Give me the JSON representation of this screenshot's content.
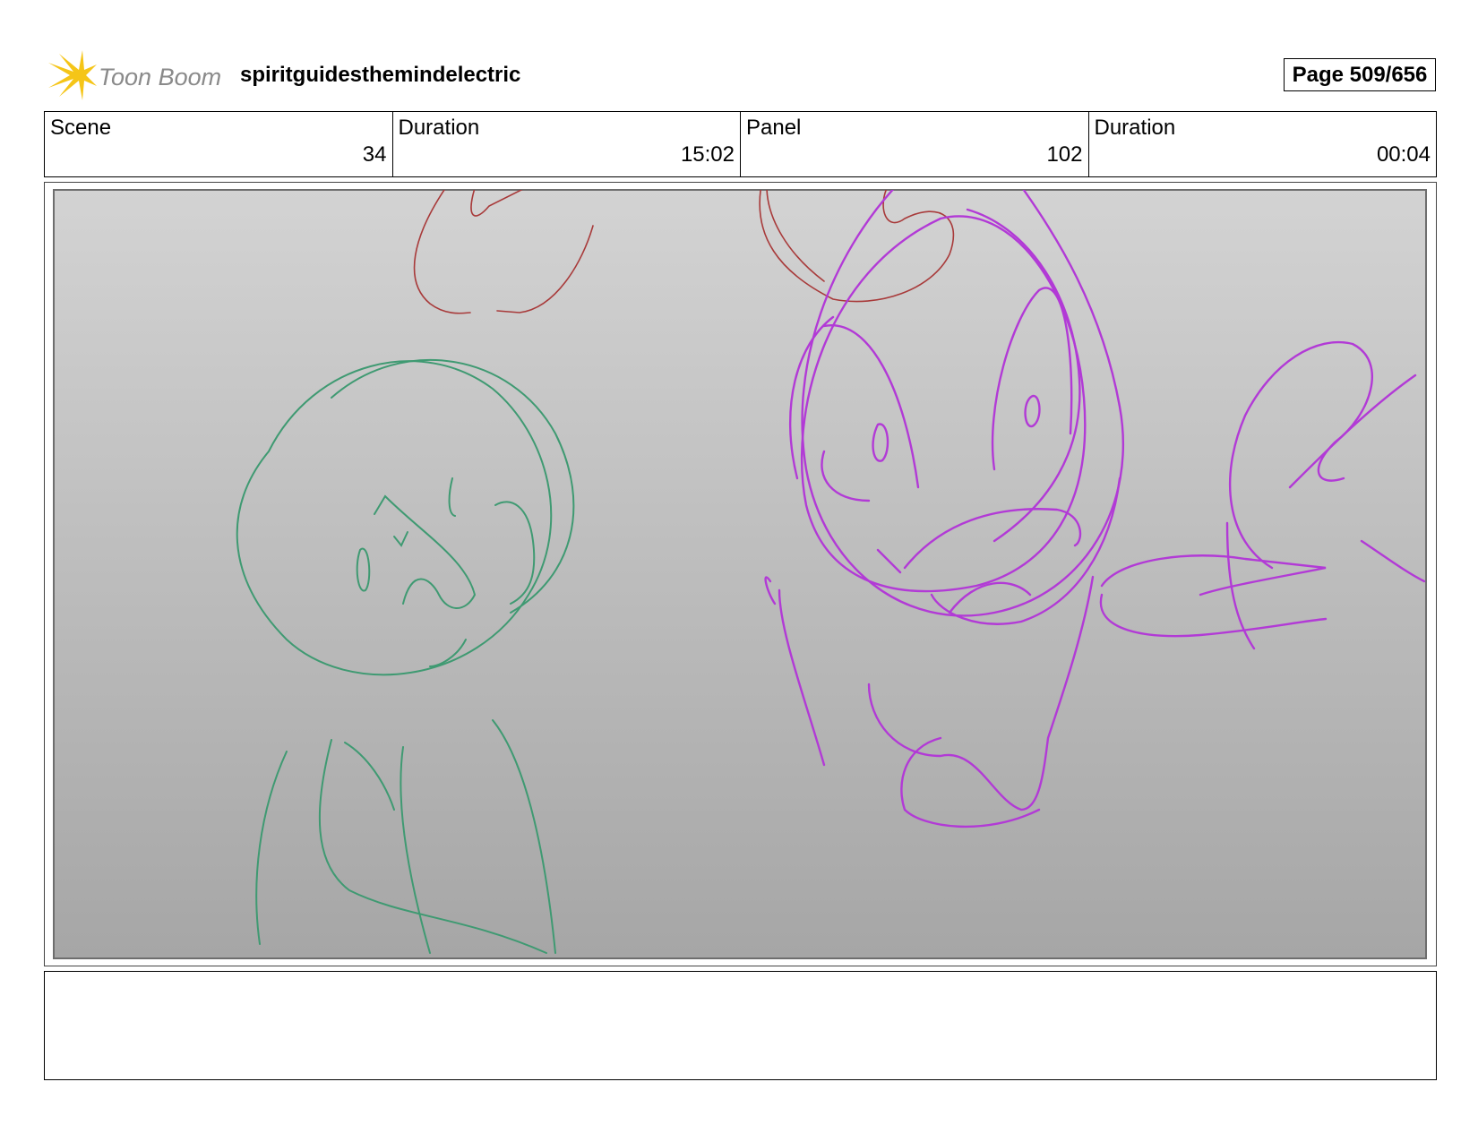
{
  "header": {
    "logo_text": "Toon Boom",
    "project_name": "spiritguidesthemindelectric",
    "page_label": "Page 509/656"
  },
  "meta": {
    "scene_label": "Scene",
    "scene_value": "34",
    "scene_duration_label": "Duration",
    "scene_duration_value": "15:02",
    "panel_label": "Panel",
    "panel_value": "102",
    "panel_duration_label": "Duration",
    "panel_duration_value": "00:04"
  },
  "colors": {
    "logo_yellow": "#f5c518",
    "logo_text_gray": "#8a8a8a",
    "sketch_green": "#3f9a72",
    "sketch_magenta": "#b23ad6",
    "sketch_red": "#a83a3a",
    "panel_top": "#d3d3d3",
    "panel_bottom": "#a6a6a6"
  },
  "notes": {
    "text": ""
  }
}
